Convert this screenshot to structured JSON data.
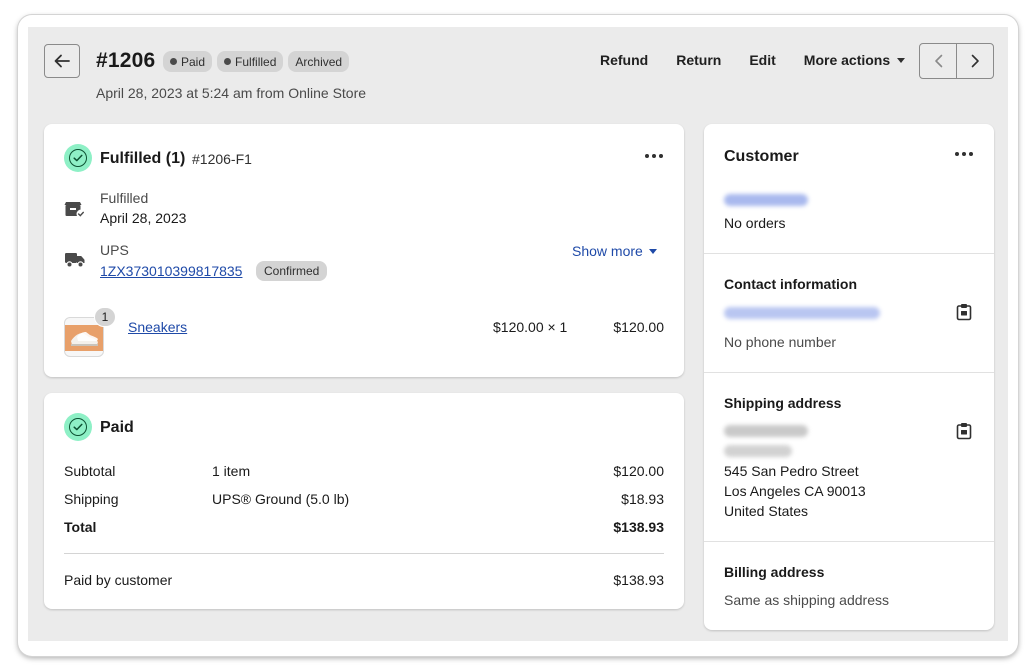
{
  "header": {
    "order_number": "#1206",
    "badges": [
      {
        "label": "Paid",
        "dot": true
      },
      {
        "label": "Fulfilled",
        "dot": true
      },
      {
        "label": "Archived",
        "dot": false
      }
    ],
    "subtitle": "April 28, 2023 at 5:24 am from Online Store",
    "actions": {
      "refund": "Refund",
      "return": "Return",
      "edit": "Edit",
      "more_actions": "More actions"
    }
  },
  "fulfilled_card": {
    "title": "Fulfilled (1)",
    "fulfillment_id": "#1206-F1",
    "status_label": "Fulfilled",
    "status_date": "April 28, 2023",
    "carrier": "UPS",
    "tracking_number": "1ZX373010399817835",
    "tracking_status": "Confirmed",
    "show_more": "Show more",
    "item": {
      "quantity_badge": "1",
      "name": "Sneakers",
      "unit_price_qty": "$120.00 × 1",
      "line_total": "$120.00"
    }
  },
  "paid_card": {
    "title": "Paid",
    "rows": [
      {
        "label": "Subtotal",
        "detail": "1 item",
        "amount": "$120.00"
      },
      {
        "label": "Shipping",
        "detail": "UPS® Ground (5.0 lb)",
        "amount": "$18.93"
      },
      {
        "label": "Total",
        "detail": "",
        "amount": "$138.93"
      }
    ],
    "paid_by_label": "Paid by customer",
    "paid_by_amount": "$138.93"
  },
  "customer": {
    "title": "Customer",
    "orders": "No orders"
  },
  "contact": {
    "title": "Contact information",
    "phone": "No phone number"
  },
  "shipping": {
    "title": "Shipping address",
    "line1": "545 San Pedro Street",
    "line2": "Los Angeles CA 90013",
    "line3": "United States"
  },
  "billing": {
    "title": "Billing address",
    "text": "Same as shipping address"
  },
  "colors": {
    "page_bg": "#ebebeb",
    "success_badge": "#8ef0c6",
    "link": "#1f4aa8",
    "badge_bg": "#d4d4d4"
  },
  "icons": {
    "back": "arrow-left-icon",
    "prev": "chevron-left-icon",
    "next": "chevron-right-icon",
    "fulfilled": "check-circle-icon",
    "package": "package-check-icon",
    "truck": "truck-icon",
    "clipboard": "clipboard-icon",
    "more": "ellipsis-icon"
  }
}
